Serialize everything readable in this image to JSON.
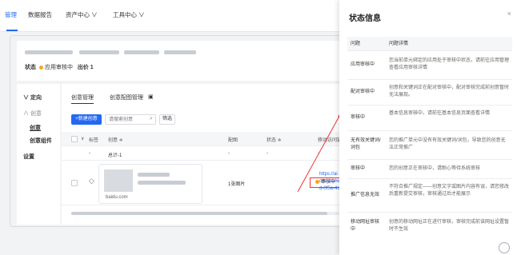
{
  "topnav": {
    "tabs": [
      {
        "label": "管理"
      },
      {
        "label": "数据报告"
      },
      {
        "label": "资产中心 ∨"
      },
      {
        "label": "工具中心 ∨"
      }
    ]
  },
  "info": {
    "status_label": "状态",
    "status_value": "应用审核中",
    "bid_label": "出价",
    "bid_value": "1"
  },
  "sidebar": {
    "items": [
      {
        "label": "∨ 定向"
      },
      {
        "label": "∧ 创意"
      },
      {
        "label": "创意"
      },
      {
        "label": "创意组件"
      },
      {
        "label": "设置"
      }
    ]
  },
  "main": {
    "subtabs": [
      {
        "label": "创意管理"
      },
      {
        "label": "创意配图管理"
      }
    ],
    "new_button": "+新建创意",
    "search_placeholder": "请搜索创意",
    "filter_button": "筛选",
    "columns": [
      "标签",
      "创意 ≑",
      "配图",
      "状态 ≑",
      "移动访问链"
    ],
    "total_row": {
      "label": "总计-1",
      "dash1": "-",
      "dash2": "-",
      "dash3": "-",
      "dash4": "-"
    },
    "row": {
      "domain": "baidu.com",
      "image_count": "1张图片",
      "status": "审核中",
      "url_lines": [
        "https://ai",
        "om/site/w",
        "d-0f5a-4c"
      ]
    }
  },
  "drawer": {
    "title": "状态信息",
    "close": "×",
    "header": {
      "k": "问题",
      "v": "问题详情"
    },
    "rows": [
      {
        "k": "应用审核中",
        "v": "您当前单元绑定的应用处于审核中状态，请前往应用管理查看应用审核详情"
      },
      {
        "k": "配对审核中",
        "v": "创意和关键词正在配对审核中，配对审核完成前创意暂时无法展现。"
      },
      {
        "k": "审核中",
        "v": "基本信息审核中，请前往基本信息页面查看详情"
      },
      {
        "k": "无有效关键词/词包",
        "v": "您的推广单元中没有有效关键词/词包，导致您的创意无法正常推广"
      },
      {
        "k": "审核中",
        "v": "您的创意正在审核中，请耐心等待系统审核"
      },
      {
        "k": "推广信息无效",
        "v": "不符合推广规定——创意文字或图片内容有误，请您修改后重新提交审核，审核通过后才能展示"
      },
      {
        "k": "移动网址审核中",
        "v": "创意的移动网址正在进行审核，审核完成前该网址设置暂时不生效"
      }
    ]
  },
  "colors": {
    "accent": "#2468f2",
    "warning": "#f5a623",
    "annotation": "#ee3333"
  }
}
